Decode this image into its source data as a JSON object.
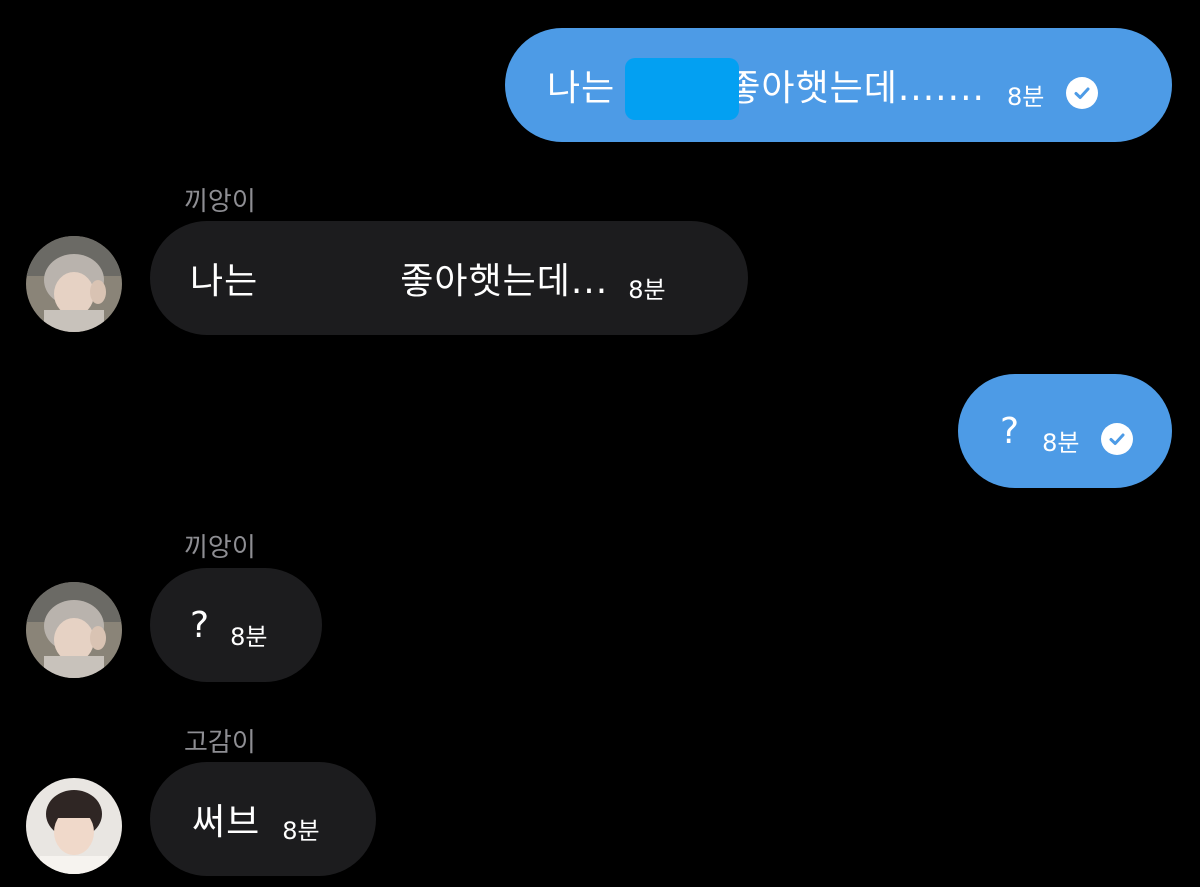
{
  "messages": [
    {
      "id": "m1",
      "direction": "out",
      "text_before": "나는",
      "text_after": "좋아햇는데.......",
      "time": "8분",
      "read_icon": "check-circle-icon",
      "redacted": true
    },
    {
      "id": "m2",
      "direction": "in",
      "sender": "끼앙이",
      "text_before": "나는",
      "text_after": "좋아햇는데...",
      "time": "8분",
      "avatar": "avatar-kkiangi"
    },
    {
      "id": "m3",
      "direction": "out",
      "text": "?",
      "time": "8분",
      "read_icon": "check-circle-icon"
    },
    {
      "id": "m4",
      "direction": "in",
      "sender": "끼앙이",
      "text": "?",
      "time": "8분",
      "avatar": "avatar-kkiangi"
    },
    {
      "id": "m5",
      "direction": "in",
      "sender": "고감이",
      "text": "써브",
      "time": "8분",
      "avatar": "avatar-gogami"
    }
  ],
  "colors": {
    "background": "#000000",
    "outgoing_bubble": "#4d9be6",
    "incoming_bubble": "#1c1c1e",
    "sender_label": "#8e8e93",
    "redaction": "#03a0f2"
  }
}
